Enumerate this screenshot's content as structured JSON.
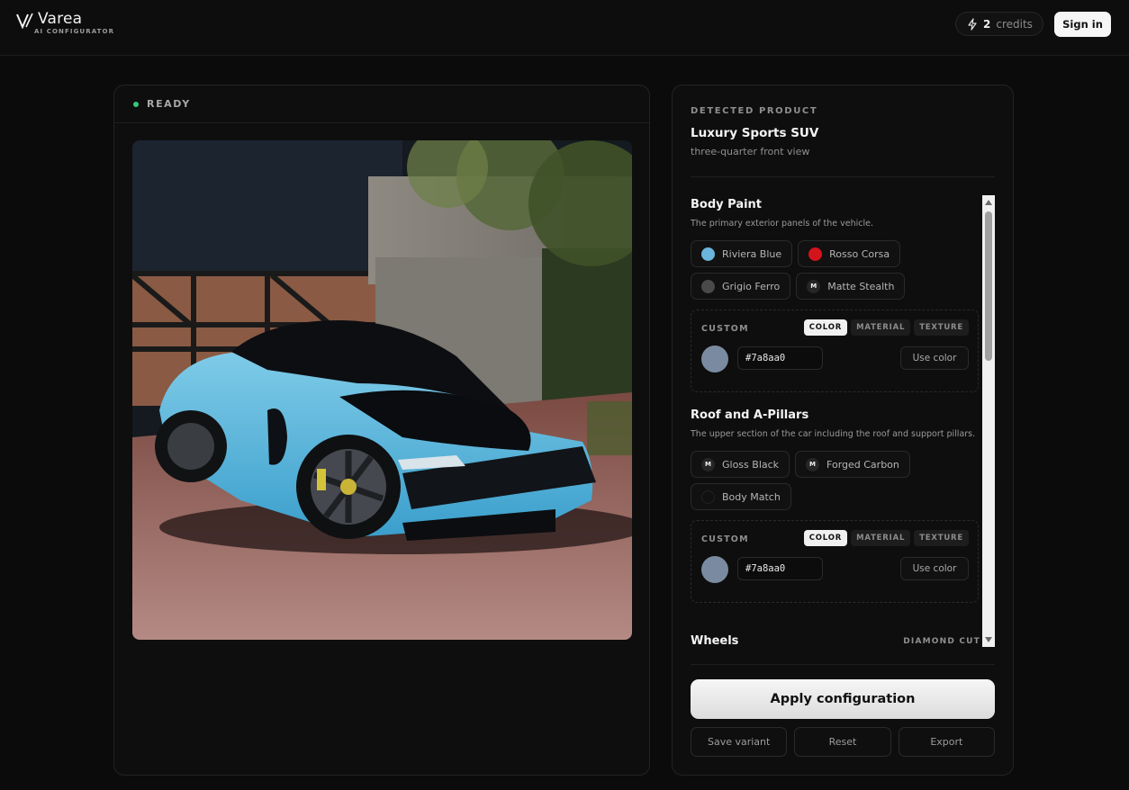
{
  "header": {
    "brand_name": "Varea",
    "brand_sub": "AI CONFIGURATOR",
    "credits_count": "2",
    "credits_label": "credits",
    "signin_label": "Sign in"
  },
  "preview": {
    "status": "READY",
    "status_color": "#34c67a"
  },
  "product": {
    "detected_label": "DETECTED PRODUCT",
    "name": "Luxury Sports SUV",
    "view": "three-quarter front view"
  },
  "sections": [
    {
      "title": "Body Paint",
      "description": "The primary exterior panels of the vehicle.",
      "options": [
        {
          "label": "Riviera Blue",
          "swatch": "#6bb4dc"
        },
        {
          "label": "Rosso Corsa",
          "swatch": "#d4141c"
        },
        {
          "label": "Grigio Ferro",
          "swatch": "#4a4a4a"
        },
        {
          "label": "Matte Stealth",
          "swatch": "material"
        }
      ],
      "custom": {
        "label": "CUSTOM",
        "tabs": [
          "COLOR",
          "MATERIAL",
          "TEXTURE"
        ],
        "active_tab": "COLOR",
        "hex_value": "#7a8aa0",
        "use_label": "Use color"
      }
    },
    {
      "title": "Roof and A-Pillars",
      "description": "The upper section of the car including the roof and support pillars.",
      "options": [
        {
          "label": "Gloss Black",
          "swatch": "material"
        },
        {
          "label": "Forged Carbon",
          "swatch": "material"
        },
        {
          "label": "Body Match",
          "swatch": "#111111"
        }
      ],
      "custom": {
        "label": "CUSTOM",
        "tabs": [
          "COLOR",
          "MATERIAL",
          "TEXTURE"
        ],
        "active_tab": "COLOR",
        "hex_value": "#7a8aa0",
        "use_label": "Use color"
      }
    },
    {
      "title": "Wheels",
      "current_value": "DIAMOND CUT"
    }
  ],
  "material_badge": "M",
  "actions": {
    "apply_label": "Apply configuration",
    "save_label": "Save variant",
    "reset_label": "Reset",
    "export_label": "Export"
  },
  "colors": {
    "background": "#0b0b0b",
    "accent_white": "#f5f5f5",
    "custom_swatch": "#7a8aa0"
  }
}
